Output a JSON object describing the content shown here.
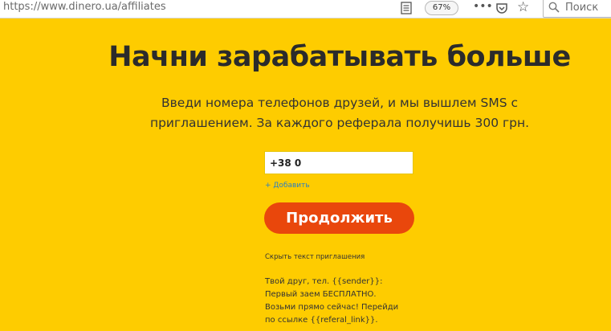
{
  "browser": {
    "url": "https://www.dinero.ua/affiliates",
    "zoom": "67%",
    "search_placeholder": "Поиск"
  },
  "page": {
    "headline": "Начни зарабатывать больше",
    "subtitle_line1": "Введи номера телефонов друзей, и мы вышлем SMS с",
    "subtitle_line2": "приглашением. За каждого реферала получишь 300 грн.",
    "phone_value": "+38 0",
    "add_link": "+ Добавить",
    "continue_label": "Продолжить",
    "hide_invite_text": "Скрыть текст приглашения",
    "invite_lines": [
      "Твой друг, тел. {{sender}}:",
      "Первый заем БЕСПЛАТНО.",
      "Возьми прямо сейчас! Перейди",
      "по ссылке {{referal_link}}."
    ]
  },
  "colors": {
    "background": "#fecc00",
    "button": "#e9470c",
    "link": "#2c7fc0"
  },
  "icons": [
    "reader-view-icon",
    "more-icon",
    "pocket-icon",
    "bookmark-star-icon",
    "search-icon"
  ]
}
